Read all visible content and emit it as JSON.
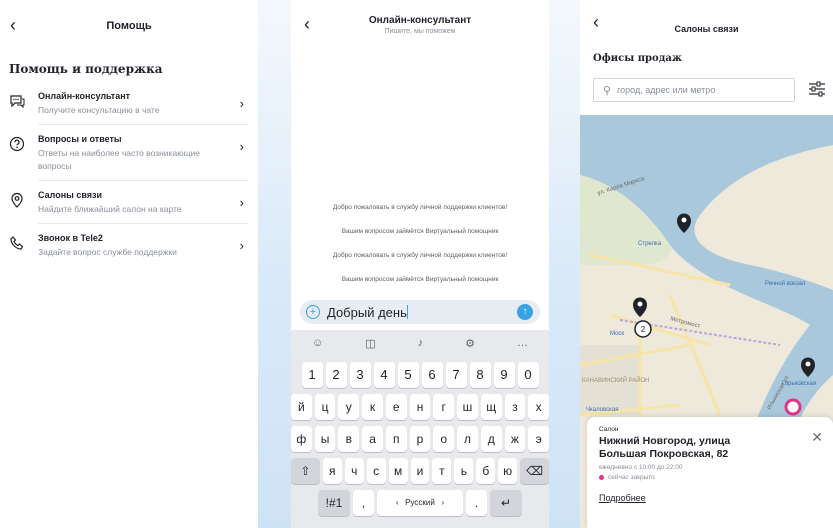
{
  "help": {
    "title": "Помощь",
    "section": "Помощь и поддержка",
    "items": [
      {
        "title": "Онлайн-консультант",
        "subtitle": "Получите консультацию в чате"
      },
      {
        "title": "Вопросы и ответы",
        "subtitle": "Ответы на наиболее часто возникающие вопросы"
      },
      {
        "title": "Салоны связи",
        "subtitle": "Найдите ближайший салон на карте"
      },
      {
        "title": "Звонок в Tele2",
        "subtitle": "Задайте вопрос службе поддержки"
      }
    ]
  },
  "chat": {
    "title": "Онлайн-консультант",
    "subtitle": "Пишите, мы поможем",
    "messages": [
      "Добро пожаловать в службу личной поддержки клиентов!",
      "Вашим вопросом займётся Виртуальный помощник",
      "Добро пожаловать в службу личной поддержки клиентов!",
      "Вашим вопросом займётся Виртуальный помощник"
    ],
    "input_value": "Добрый день"
  },
  "keyboard": {
    "numbers": [
      "1",
      "2",
      "3",
      "4",
      "5",
      "6",
      "7",
      "8",
      "9",
      "0"
    ],
    "row1": [
      "й",
      "ц",
      "у",
      "к",
      "е",
      "н",
      "г",
      "ш",
      "щ",
      "з",
      "х"
    ],
    "row2": [
      "ф",
      "ы",
      "в",
      "а",
      "п",
      "р",
      "о",
      "л",
      "д",
      "ж",
      "э"
    ],
    "row3": [
      "я",
      "ч",
      "с",
      "м",
      "и",
      "т",
      "ь",
      "б",
      "ю"
    ],
    "symbols_key": "!#1",
    "comma_key": ",",
    "language": "Русский",
    "lang_left": "‹",
    "lang_right": "›",
    "period_key": "."
  },
  "salons": {
    "title": "Салоны связи",
    "section": "Офисы продаж",
    "search_placeholder": "город, адрес или метро",
    "map_labels": {
      "street_marksa": "ул. Карла Маркса",
      "strelka": "Стрелка",
      "rechnoy": "Речной вокзал",
      "moskovskaya": "Моск",
      "metromost": "Метромост",
      "kanavinsky": "КАНАВИНСКИЙ РАЙОН",
      "chkalovskaya": "Чкаловская",
      "gorkovskaya": "Горьковская",
      "ilyinskaya": "Ильинская ул",
      "cluster": "2"
    },
    "card": {
      "category": "Салон",
      "address": "Нижний Новгород, улица Большая Покровская, 82",
      "hours": "ежедневно с 10:00 до 22:00",
      "status": "сейчас закрыто",
      "more": "Подробнее"
    }
  },
  "colors": {
    "accent": "#3aa3e6",
    "closed": "#e0338a",
    "river": "#a9c8dc",
    "land": "#efe9dc"
  }
}
